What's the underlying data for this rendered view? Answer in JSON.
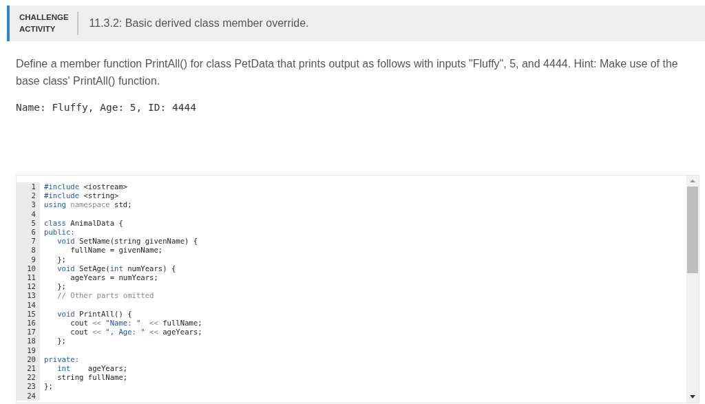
{
  "header": {
    "badge_line_1": "CHALLENGE",
    "badge_line_2": "ACTIVITY",
    "title": "11.3.2: Basic derived class member override."
  },
  "instructions": "Define a member function PrintAll() for class PetData that prints output as follows with inputs \"Fluffy\", 5, and 4444. Hint: Make use of the base class' PrintAll() function.",
  "sample_output": "Name: Fluffy, Age: 5, ID: 4444",
  "editor": {
    "lines": [
      {
        "number": "1",
        "segments": [
          {
            "kind": "keyword",
            "text": "#include"
          },
          {
            "kind": "plain",
            "text": " <iostream>"
          }
        ]
      },
      {
        "number": "2",
        "segments": [
          {
            "kind": "keyword",
            "text": "#include"
          },
          {
            "kind": "plain",
            "text": " <string>"
          }
        ]
      },
      {
        "number": "3",
        "segments": [
          {
            "kind": "keyword",
            "text": "using"
          },
          {
            "kind": "muted",
            "text": " namespace"
          },
          {
            "kind": "plain",
            "text": " std;"
          }
        ]
      },
      {
        "number": "4"
      },
      {
        "number": "5",
        "segments": [
          {
            "kind": "keyword",
            "text": "class"
          },
          {
            "kind": "plain",
            "text": " AnimalData {"
          }
        ]
      },
      {
        "number": "6",
        "segments": [
          {
            "kind": "keyword",
            "text": "public:"
          }
        ]
      },
      {
        "number": "7",
        "segments": [
          {
            "kind": "keyword",
            "text": "   void"
          },
          {
            "kind": "plain",
            "text": " SetName(string givenName) {"
          }
        ]
      },
      {
        "number": "8",
        "segments": [
          {
            "kind": "plain",
            "text": "      fullName = givenName;"
          }
        ]
      },
      {
        "number": "9",
        "segments": [
          {
            "kind": "plain",
            "text": "   };"
          }
        ]
      },
      {
        "number": "10",
        "segments": [
          {
            "kind": "keyword",
            "text": "   void"
          },
          {
            "kind": "plain",
            "text": " SetAge("
          },
          {
            "kind": "keyword",
            "text": "int"
          },
          {
            "kind": "plain",
            "text": " numYears) {"
          }
        ]
      },
      {
        "number": "11",
        "segments": [
          {
            "kind": "plain",
            "text": "      ageYears = numYears;"
          }
        ]
      },
      {
        "number": "12",
        "segments": [
          {
            "kind": "plain",
            "text": "   };"
          }
        ]
      },
      {
        "number": "13",
        "segments": [
          {
            "kind": "comment",
            "text": "   // Other parts omitted"
          }
        ]
      },
      {
        "number": "14"
      },
      {
        "number": "15",
        "segments": [
          {
            "kind": "keyword",
            "text": "   void"
          },
          {
            "kind": "plain",
            "text": " PrintAll() {"
          }
        ]
      },
      {
        "number": "16",
        "segments": [
          {
            "kind": "plain",
            "text": "      cout "
          },
          {
            "kind": "muted",
            "text": "<< "
          },
          {
            "kind": "string",
            "text": "\"Name: \"  "
          },
          {
            "kind": "muted",
            "text": "<<"
          },
          {
            "kind": "plain",
            "text": " fullName;"
          }
        ]
      },
      {
        "number": "17",
        "segments": [
          {
            "kind": "plain",
            "text": "      cout "
          },
          {
            "kind": "muted",
            "text": "<< "
          },
          {
            "kind": "string",
            "text": "\", Age: \" "
          },
          {
            "kind": "muted",
            "text": "<<"
          },
          {
            "kind": "plain",
            "text": " ageYears;"
          }
        ]
      },
      {
        "number": "18",
        "segments": [
          {
            "kind": "plain",
            "text": "   };"
          }
        ]
      },
      {
        "number": "19"
      },
      {
        "number": "20",
        "segments": [
          {
            "kind": "keyword",
            "text": "private:"
          }
        ]
      },
      {
        "number": "21",
        "segments": [
          {
            "kind": "keyword",
            "text": "   int"
          },
          {
            "kind": "plain",
            "text": "    ageYears;"
          }
        ]
      },
      {
        "number": "22",
        "segments": [
          {
            "kind": "plain",
            "text": "   string fullName;"
          }
        ]
      },
      {
        "number": "23",
        "segments": [
          {
            "kind": "plain",
            "text": "};"
          }
        ]
      },
      {
        "number": "24"
      }
    ]
  }
}
